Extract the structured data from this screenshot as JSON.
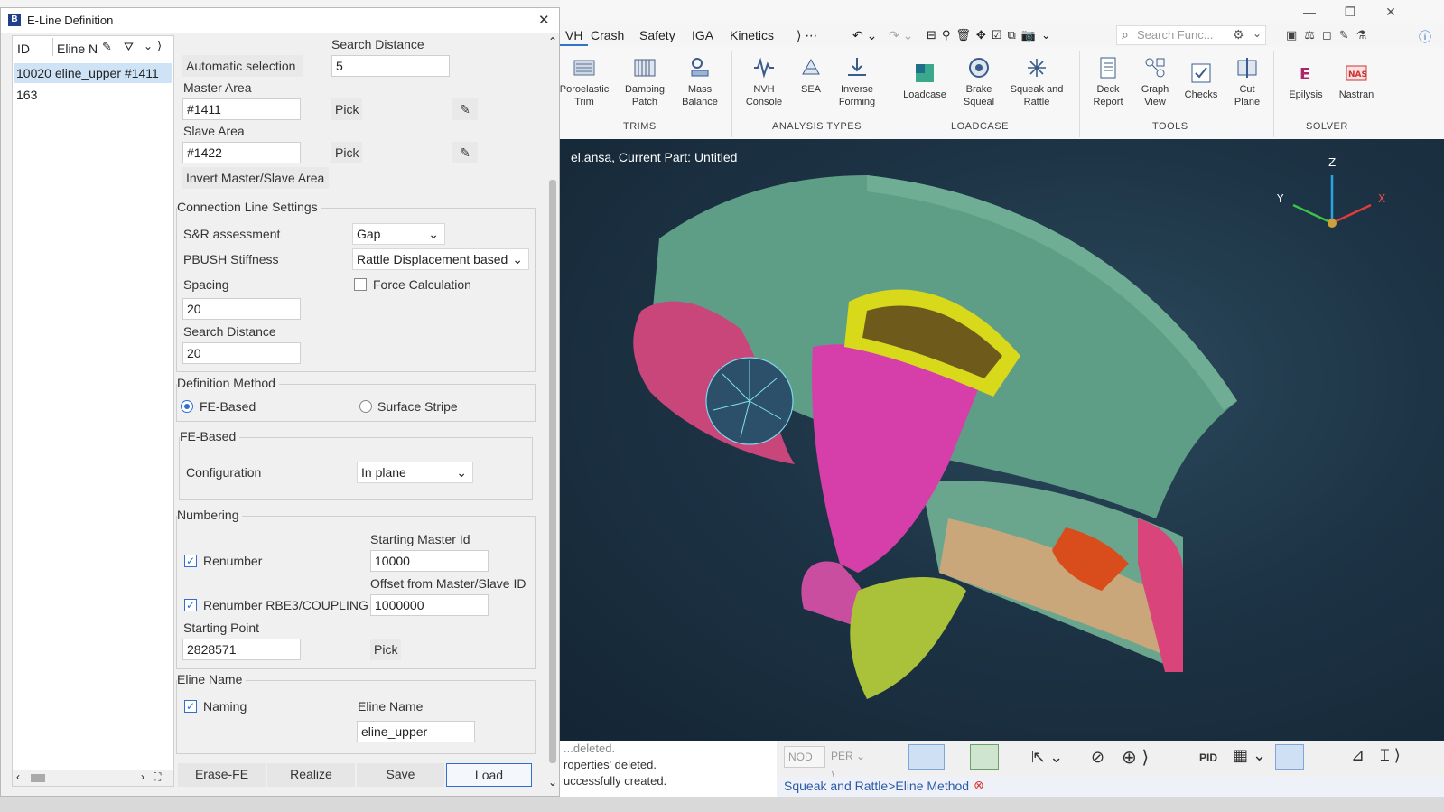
{
  "dialog": {
    "title": "E-Line Definition",
    "close_glyph": "✕",
    "list": {
      "col_id": "ID",
      "col_name": "Eline N",
      "rows": [
        {
          "text": "10020 eline_upper #1411",
          "selected": true
        },
        {
          "text": "163",
          "selected": false
        }
      ]
    },
    "area": {
      "search_distance_label": "Search Distance",
      "search_distance_value": "5",
      "auto_select_label": "Automatic selection",
      "master_area_label": "Master Area",
      "master_area_value": "#1411",
      "slave_area_label": "Slave Area",
      "slave_area_value": "#1422",
      "pick_label": "Pick",
      "invert_label": "Invert Master/Slave Area"
    },
    "connection": {
      "title": "Connection Line Settings",
      "sr_label": "S&R assessment",
      "sr_value": "Gap",
      "pbush_label": "PBUSH Stiffness",
      "pbush_value": "Rattle Displacement based",
      "spacing_label": "Spacing",
      "spacing_value": "20",
      "force_label": "Force Calculation",
      "search_label": "Search Distance",
      "search_value": "20"
    },
    "definition": {
      "title": "Definition Method",
      "fe_label": "FE-Based",
      "stripe_label": "Surface Stripe"
    },
    "febased": {
      "title": "FE-Based",
      "config_label": "Configuration",
      "config_value": "In plane"
    },
    "numbering": {
      "title": "Numbering",
      "start_master_label": "Starting Master Id",
      "start_master_value": "10000",
      "renumber_label": "Renumber",
      "offset_label": "Offset from Master/Slave ID",
      "offset_value": "1000000",
      "renumber_rbe_label": "Renumber RBE3/COUPLING",
      "start_point_label": "Starting Point",
      "start_point_value": "2828571",
      "pick_label": "Pick"
    },
    "eline": {
      "title": "Eline Name",
      "naming_label": "Naming",
      "name_label": "Eline Name",
      "name_value": "eline_upper"
    },
    "actions": {
      "erase": "Erase-FE",
      "realize": "Realize",
      "save": "Save",
      "load": "Load"
    }
  },
  "app": {
    "tabs": [
      "VH",
      "Crash",
      "Safety",
      "IGA",
      "Kinetics"
    ],
    "search_placeholder": "Search Func...",
    "ribbon": {
      "buttons": [
        {
          "label": "Poroelastic\nTrim"
        },
        {
          "label": "Damping\nPatch"
        },
        {
          "label": "Mass\nBalance"
        },
        {
          "label": "NVH\nConsole"
        },
        {
          "label": "SEA"
        },
        {
          "label": "Inverse\nForming"
        },
        {
          "label": "Loadcase"
        },
        {
          "label": "Brake\nSqueal"
        },
        {
          "label": "Squeak and\nRattle"
        },
        {
          "label": "Deck\nReport"
        },
        {
          "label": "Graph\nView"
        },
        {
          "label": "Checks"
        },
        {
          "label": "Cut\nPlane"
        },
        {
          "label": "Epilysis"
        },
        {
          "label": "Nastran"
        }
      ],
      "groups": [
        "TRIMS",
        "ANALYSIS TYPES",
        "LOADCASE",
        "TOOLS",
        "SOLVER"
      ]
    },
    "viewport_title": "el.ansa,  Current Part: Untitled",
    "axes": {
      "x": "X",
      "y": "Y",
      "z": "Z"
    },
    "console_lines": [
      "...deleted.",
      "roperties' deleted.",
      "uccessfully created."
    ],
    "bottom": {
      "nod": "NOD",
      "per": "PER",
      "pid": "PID"
    },
    "status": "Squeak and Rattle>Eline Method"
  },
  "colors": {
    "accent": "#2e6fd1",
    "selected_row": "#cfe3f7",
    "dashboard_green": "#5f9e86",
    "part_pink": "#d33fa6",
    "part_yellow": "#d9d91c"
  }
}
